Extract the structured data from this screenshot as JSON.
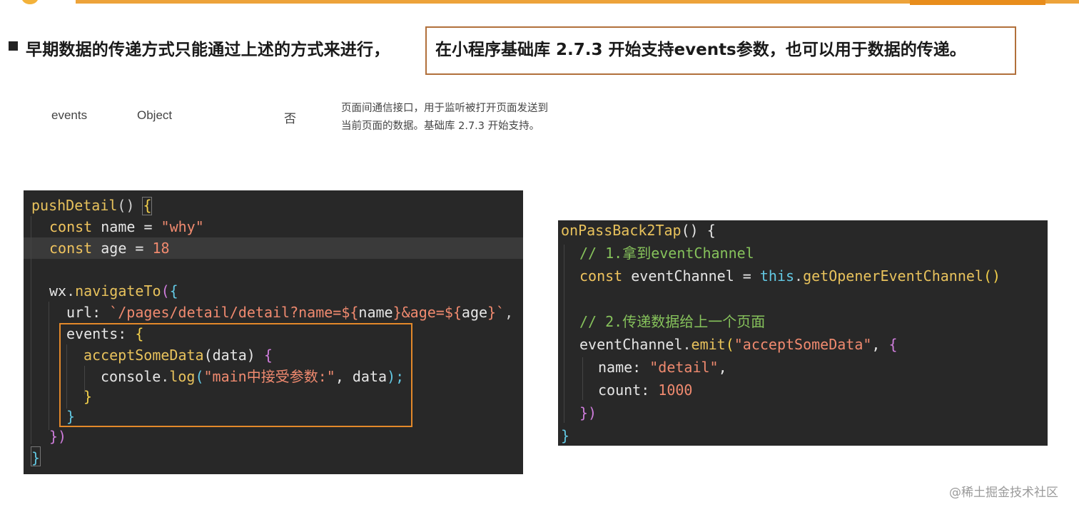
{
  "heading": {
    "text": "早期数据的传递方式只能通过上述的方式来进行，",
    "highlight": "在小程序基础库 2.7.3 开始支持events参数，也可以用于数据的传递。"
  },
  "param_row": {
    "name": "events",
    "type": "Object",
    "required": "否",
    "desc_line1": "页面间通信接口，用于监听被打开页面发送到",
    "desc_line2": "当前页面的数据。基础库 2.7.3 开始支持。"
  },
  "left_code": {
    "l1_fn": "pushDetail",
    "l1_rest": "() ",
    "l1_brace": "{",
    "l2_kw": "const",
    "l2_var": " name = ",
    "l2_str": "\"why\"",
    "l3_kw": "const",
    "l3_var": " age = ",
    "l3_num": "18",
    "l5_obj": "wx",
    "l5_dot": ".",
    "l5_fn": "navigateTo",
    "l5_paren": "(",
    "l5_brace": "{",
    "l6_key": "url: ",
    "l6_str": "`/pages/detail/detail?name=${",
    "l6_v1": "name",
    "l6_str2": "}&age=${",
    "l6_v2": "age",
    "l6_str3": "}`",
    "l6_comma": ",",
    "l7_key": "events: ",
    "l7_brace": "{",
    "l8_fn": "acceptSomeData",
    "l8_args": "(data) ",
    "l8_brace": "{",
    "l9_obj": "console",
    "l9_dot": ".",
    "l9_fn": "log",
    "l9_paren": "(",
    "l9_str": "\"main中接受参数:\"",
    "l9_rest": ", data",
    "l9_close": ");",
    "l10_brace": "}",
    "l11_brace": "}",
    "l12_close": "})",
    "l13_brace": "}"
  },
  "right_code": {
    "l1_fn": "onPassBack2Tap",
    "l1_rest": "() {",
    "l2_comment": "// 1.拿到eventChannel",
    "l3_kw": "const",
    "l3_var": " eventChannel = ",
    "l3_this": "this",
    "l3_dot": ".",
    "l3_fn": "getOpenerEventChannel",
    "l3_paren": "()",
    "l5_comment": "// 2.传递数据给上一个页面",
    "l6_obj": "eventChannel",
    "l6_dot": ".",
    "l6_fn": "emit",
    "l6_paren": "(",
    "l6_str": "\"acceptSomeData\"",
    "l6_comma": ", ",
    "l6_brace": "{",
    "l7_key": "name: ",
    "l7_str": "\"detail\"",
    "l7_comma": ",",
    "l8_key": "count: ",
    "l8_num": "1000",
    "l9_close": "})",
    "l10_brace": "}"
  },
  "watermark": "@稀土掘金技术社区"
}
